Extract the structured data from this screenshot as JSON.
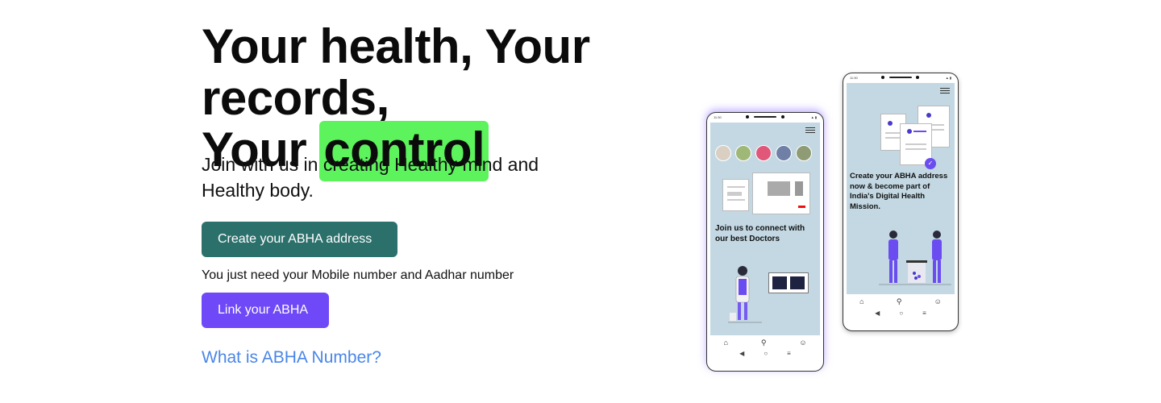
{
  "hero": {
    "headline_line1": "Your health, Your records,",
    "headline_line2_prefix": "Your ",
    "headline_highlight": "control",
    "subtitle": "Join with us in creating Healthy mind and Healthy body.",
    "create_button": "Create your ABHA address",
    "note": "You just need your Mobile number and Aadhar number",
    "link_button": "Link your ABHA",
    "what_is_link": "What is ABHA Number?"
  },
  "phone1": {
    "time": "11:30",
    "screen_text": "Join us to connect with our best Doctors"
  },
  "phone2": {
    "time": "11:30",
    "screen_text": "Create your ABHA address now & become part of India's Digital Health Mission."
  },
  "colors": {
    "highlight": "#5cf35c",
    "create_button": "#2c706c",
    "link_button": "#6f49f8",
    "link_text": "#4a86e8",
    "screen_bg": "#c3d8e3",
    "illustration_purple": "#6a4cf0"
  },
  "icons": {
    "home": "home-icon",
    "search": "search-icon",
    "profile": "profile-icon",
    "back": "back-icon",
    "home_circle": "home-circle-icon",
    "recents": "recents-icon",
    "menu": "hamburger-menu-icon"
  }
}
